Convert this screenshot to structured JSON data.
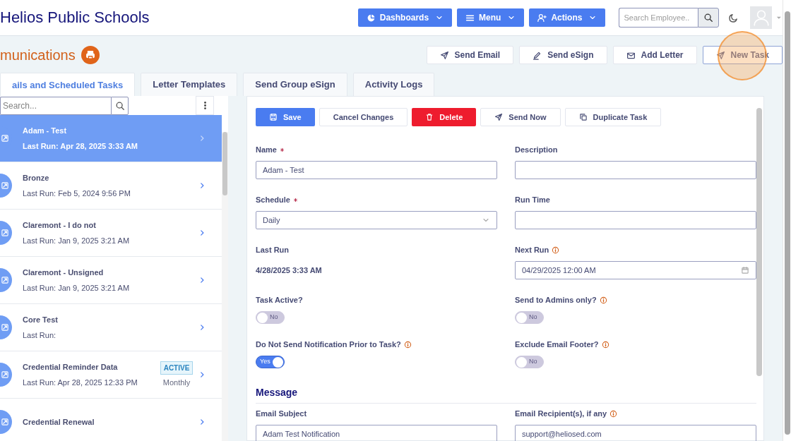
{
  "header": {
    "title": "Helios Public Schools",
    "nav_buttons": [
      {
        "label": "Dashboards"
      },
      {
        "label": "Menu"
      },
      {
        "label": "Actions"
      }
    ],
    "search": {
      "placeholder": "Search Employee.."
    }
  },
  "page": {
    "title": "munications",
    "actions": [
      {
        "label": "Send Email",
        "highlighted": false
      },
      {
        "label": "Send eSign",
        "highlighted": false
      },
      {
        "label": "Add Letter",
        "highlighted": false
      },
      {
        "label": "New Task",
        "highlighted": true
      }
    ]
  },
  "tabs": [
    {
      "label": "ails and Scheduled Tasks",
      "selected": true
    },
    {
      "label": "Letter Templates",
      "selected": false
    },
    {
      "label": "Send Group eSign",
      "selected": false
    },
    {
      "label": "Activity Logs",
      "selected": false
    }
  ],
  "task_list": {
    "search": {
      "placeholder": "Search..."
    },
    "items": [
      {
        "name": "Adam - Test",
        "last_run": "Last Run: Apr 28, 2025 3:33 AM",
        "selected": true
      },
      {
        "name": "Bronze",
        "last_run": "Last Run: Feb 5, 2024 9:56 PM",
        "selected": false
      },
      {
        "name": "Claremont - I do not",
        "last_run": "Last Run: Jan 9, 2025 3:21 AM",
        "selected": false
      },
      {
        "name": "Claremont - Unsigned",
        "last_run": "Last Run: Jan 9, 2025 3:21 AM",
        "selected": false
      },
      {
        "name": "Core Test",
        "last_run": "Last Run:",
        "selected": false
      },
      {
        "name": "Credential Reminder Data",
        "last_run": "Last Run: Apr 28, 2025 12:33 PM",
        "badge": "ACTIVE",
        "frequency": "Monthly",
        "selected": false
      },
      {
        "name": "Credential Renewal",
        "selected": false
      }
    ]
  },
  "toolbar": [
    {
      "label": "Save",
      "kind": "primary"
    },
    {
      "label": "Cancel Changes",
      "kind": "plain"
    },
    {
      "label": "Delete",
      "kind": "danger"
    },
    {
      "label": "Send Now",
      "kind": "plain"
    },
    {
      "label": "Duplicate Task",
      "kind": "plain"
    }
  ],
  "form": {
    "fields": [
      {
        "label": "Name",
        "kind": "text",
        "value": "Adam - Test",
        "required": true,
        "info": false
      },
      {
        "label": "Description",
        "kind": "text",
        "required": false,
        "info": false
      },
      {
        "label": "Schedule",
        "kind": "select",
        "value": "Daily",
        "required": true,
        "info": false
      },
      {
        "label": "Run Time",
        "kind": "text",
        "required": false,
        "info": false
      },
      {
        "label": "Last Run",
        "kind": "static",
        "value": "4/28/2025 3:33 AM",
        "required": false,
        "info": false
      },
      {
        "label": "Next Run",
        "kind": "date",
        "value": "04/29/2025 12:00 AM",
        "required": false,
        "info": true
      },
      {
        "label": "Task Active?",
        "kind": "toggle",
        "on": false,
        "state_text": "No",
        "required": false,
        "info": false
      },
      {
        "label": "Send to Admins only?",
        "kind": "toggle",
        "on": false,
        "state_text": "No",
        "required": false,
        "info": true
      },
      {
        "label": "Do Not Send Notification Prior to Task?",
        "kind": "toggle",
        "on": true,
        "state_text": "Yes",
        "required": false,
        "info": true
      },
      {
        "label": "Exclude Email Footer?",
        "kind": "toggle",
        "on": false,
        "state_text": "No",
        "required": false,
        "info": true
      }
    ],
    "section_title": "Message",
    "message_fields": [
      {
        "label": "Email Subject",
        "kind": "text",
        "value": "Adam Test Notification",
        "required": false,
        "info": false
      },
      {
        "label": "Email Recipient(s), if any",
        "kind": "text",
        "value": "support@heliosed.com",
        "required": false,
        "info": true
      }
    ]
  }
}
